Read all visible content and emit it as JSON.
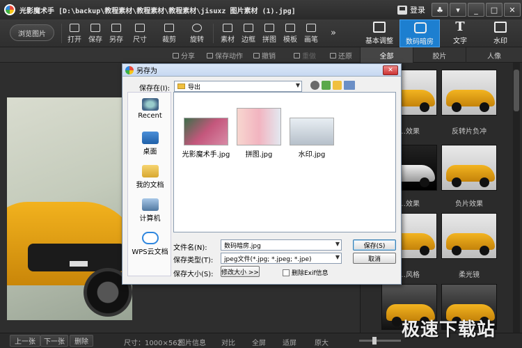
{
  "window": {
    "title": "光影魔术手 [D:\\backup\\教程素材\\教程素材\\教程素材\\jisuxz 图片素材 (1).jpg]",
    "login_label": "登录",
    "controls": [
      "♣",
      "▾",
      "_",
      "□",
      "✕"
    ]
  },
  "toolbar": {
    "browse_label": "浏览图片",
    "tools": [
      "打开",
      "保存",
      "另存",
      "尺寸",
      "裁剪",
      "旋转",
      "素材",
      "边框",
      "拼图",
      "模板",
      "画笔"
    ],
    "more_glyph": "»",
    "tabs": [
      {
        "label": "基本调整",
        "glyph": "",
        "active": false
      },
      {
        "label": "数码暗房",
        "glyph": "",
        "active": true
      },
      {
        "label": "文字",
        "glyph": "T",
        "active": false
      },
      {
        "label": "水印",
        "glyph": "",
        "active": false
      }
    ]
  },
  "subbar": {
    "share": "分享",
    "save_action": "保存动作",
    "undo": "撤销",
    "redo": "重做",
    "restore": "还原",
    "categories": [
      "全部",
      "胶片",
      "人像"
    ]
  },
  "effects": [
    {
      "label": "…效果",
      "style": "light"
    },
    {
      "label": "反转片负冲",
      "style": "light"
    },
    {
      "label": "…效果",
      "style": "mono"
    },
    {
      "label": "负片效果",
      "style": "light"
    },
    {
      "label": "…风格",
      "style": "light"
    },
    {
      "label": "柔光镜",
      "style": "light"
    },
    {
      "label": "",
      "style": "dark"
    },
    {
      "label": "",
      "style": "dark"
    }
  ],
  "status": {
    "prev": "上一张",
    "next": "下一张",
    "delete": "删除",
    "size": "尺寸：1000×562",
    "image_info": "图片信息",
    "compare": "对比",
    "fullscreen": "全屏",
    "fit": "适屏",
    "original": "原大",
    "zoom_value": 0.35,
    "watermark": "极速下载站"
  },
  "dialog": {
    "title": "另存为",
    "close": "✕",
    "save_in_label": "保存在(I):",
    "save_in_value": "导出",
    "places": [
      "Recent",
      "桌面",
      "我的文档",
      "计算机",
      "WPS云文档"
    ],
    "files": [
      {
        "name": "光影魔术手.jpg",
        "kind": "flowers"
      },
      {
        "name": "拼图.jpg",
        "kind": "portrait"
      },
      {
        "name": "水印.jpg",
        "kind": "car"
      }
    ],
    "filename_label": "文件名(N):",
    "filename_value": "数码暗房.jpg",
    "filetype_label": "保存类型(T):",
    "filetype_value": "jpeg文件(*.jpg; *.jpeg; *.jpe)",
    "filesize_label": "保存大小(S):",
    "resize_button": "修改大小 >>",
    "exif_label": "删除Exif信息",
    "save_button": "保存(S)",
    "cancel_button": "取消"
  },
  "colors": {
    "accent": "#1d7fd0",
    "car_yellow": "#f2b21e"
  }
}
